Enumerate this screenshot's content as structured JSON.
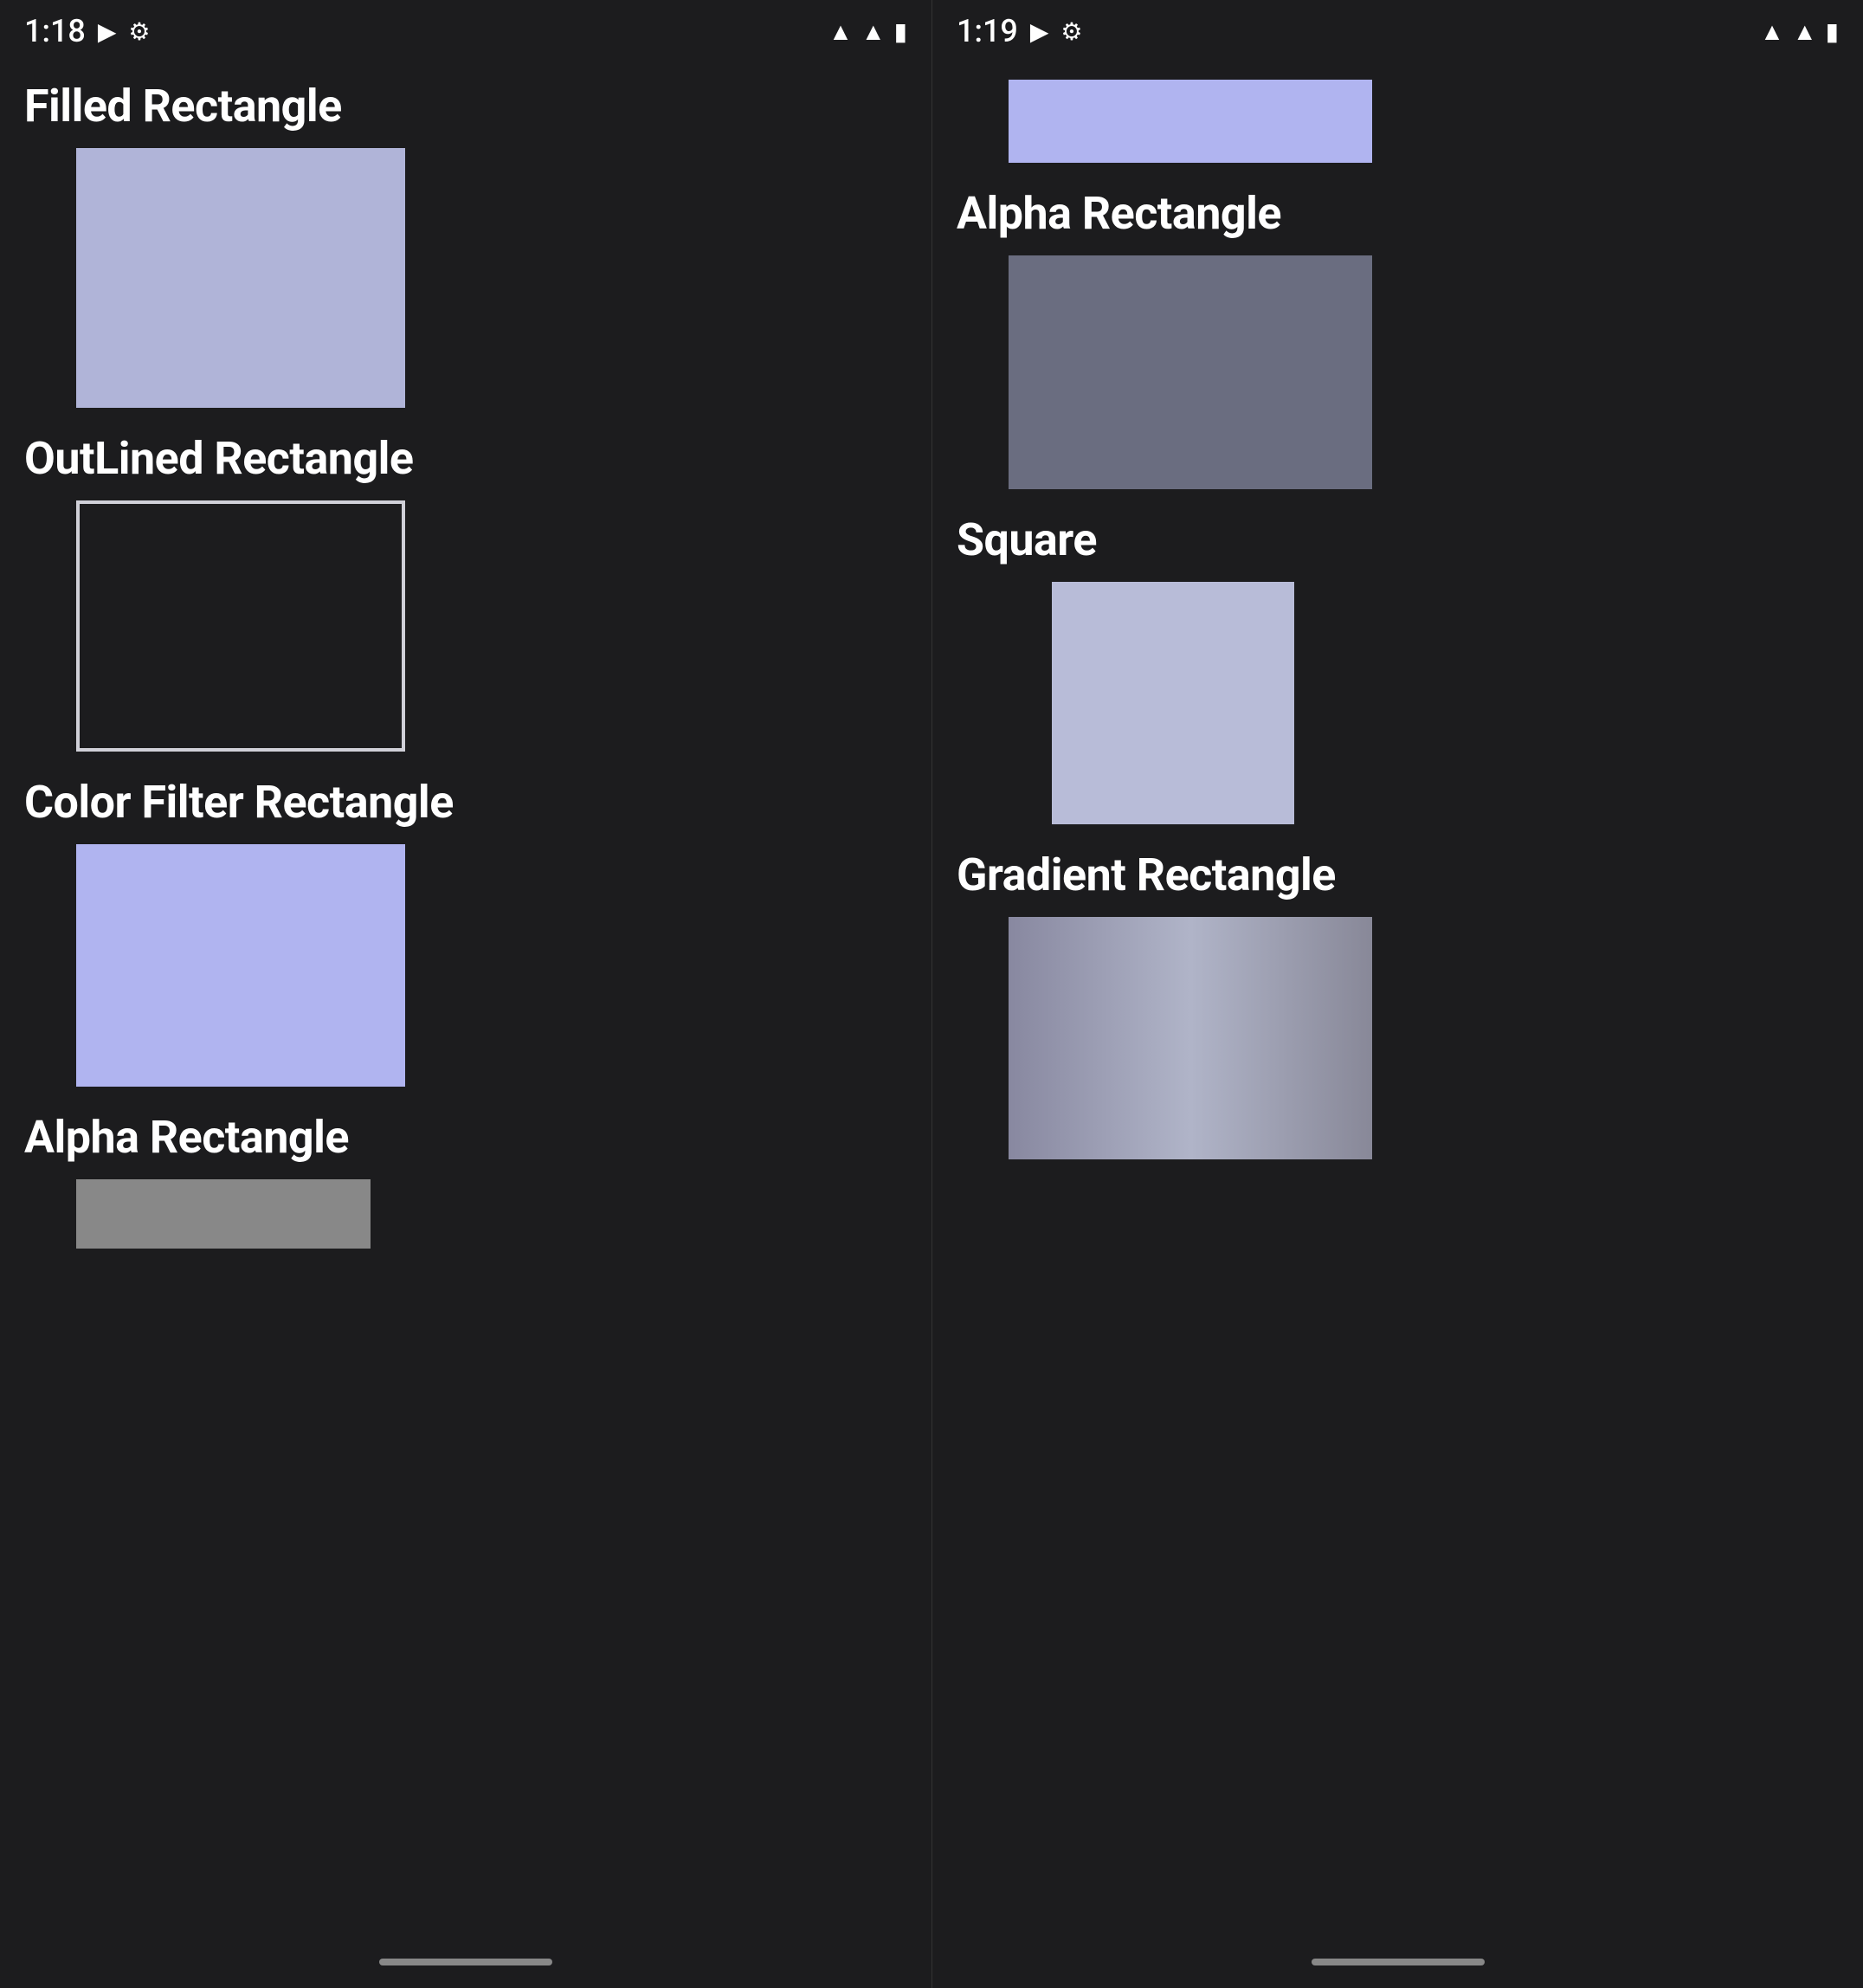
{
  "left_panel": {
    "status_bar": {
      "time": "1:18",
      "icons": [
        "youtube",
        "settings",
        "wifi",
        "signal",
        "battery"
      ]
    },
    "sections": [
      {
        "id": "filled-rectangle",
        "title": "Filled Rectangle",
        "shape": "filled",
        "color": "#b0b4d8"
      },
      {
        "id": "outlined-rectangle",
        "title": "OutLined Rectangle",
        "shape": "outlined",
        "color": "#1c1c1e",
        "border_color": "#d0d0d8"
      },
      {
        "id": "color-filter-rectangle",
        "title": "Color Filter Rectangle",
        "shape": "filled",
        "color": "#b0b4f0"
      },
      {
        "id": "alpha-rectangle-partial",
        "title": "Alpha Rectangle",
        "shape": "partial"
      }
    ]
  },
  "right_panel": {
    "status_bar": {
      "time": "1:19",
      "icons": [
        "youtube",
        "settings",
        "wifi",
        "signal",
        "battery"
      ]
    },
    "sections": [
      {
        "id": "top-partial",
        "title": "",
        "shape": "top-partial",
        "color": "#b0b4f0"
      },
      {
        "id": "alpha-rectangle",
        "title": "Alpha Rectangle",
        "shape": "filled",
        "color": "#6a6d80"
      },
      {
        "id": "square",
        "title": "Square",
        "shape": "square",
        "color": "#b8bcd8"
      },
      {
        "id": "gradient-rectangle",
        "title": "Gradient Rectangle",
        "shape": "gradient"
      }
    ]
  }
}
